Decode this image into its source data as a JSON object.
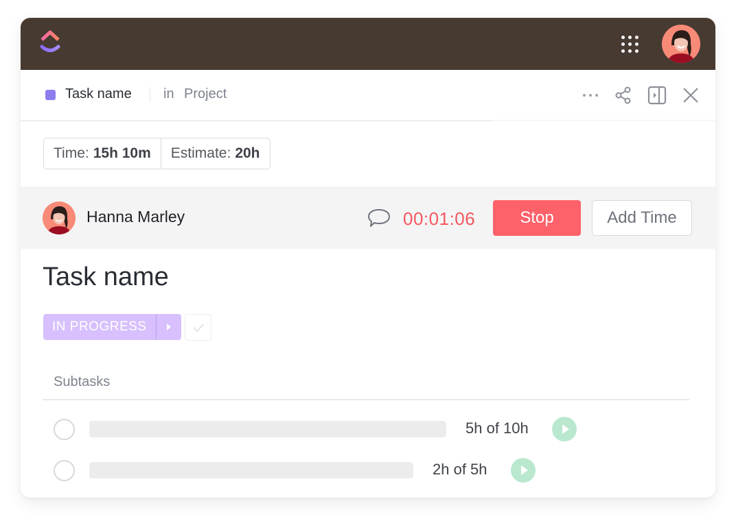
{
  "app": {
    "logo": "clickup-logo-icon",
    "apps_icon": "apps-grid-icon",
    "user_avatar": "user-avatar"
  },
  "header": {
    "task_label": "Task name",
    "in_label": "in",
    "project_label": "Project",
    "task_color": "#8d7ef0",
    "icons": [
      "more-icon",
      "share-icon",
      "sidebar-toggle-icon",
      "close-icon"
    ]
  },
  "time_summary": {
    "time_label": "Time:",
    "time_value": "15h 10m",
    "estimate_label": "Estimate:",
    "estimate_value": "20h"
  },
  "timer": {
    "user_name": "Hanna Marley",
    "elapsed": "00:01:06",
    "stop_label": "Stop",
    "add_time_label": "Add Time",
    "accent_color": "#fd616a"
  },
  "task": {
    "title": "Task name",
    "status": "IN PROGRESS",
    "status_color": "#d7c0fd"
  },
  "subtasks": {
    "label": "Subtasks",
    "items": [
      {
        "time": "5h of 10h",
        "done": false
      },
      {
        "time": "2h of 5h",
        "done": false
      }
    ]
  }
}
